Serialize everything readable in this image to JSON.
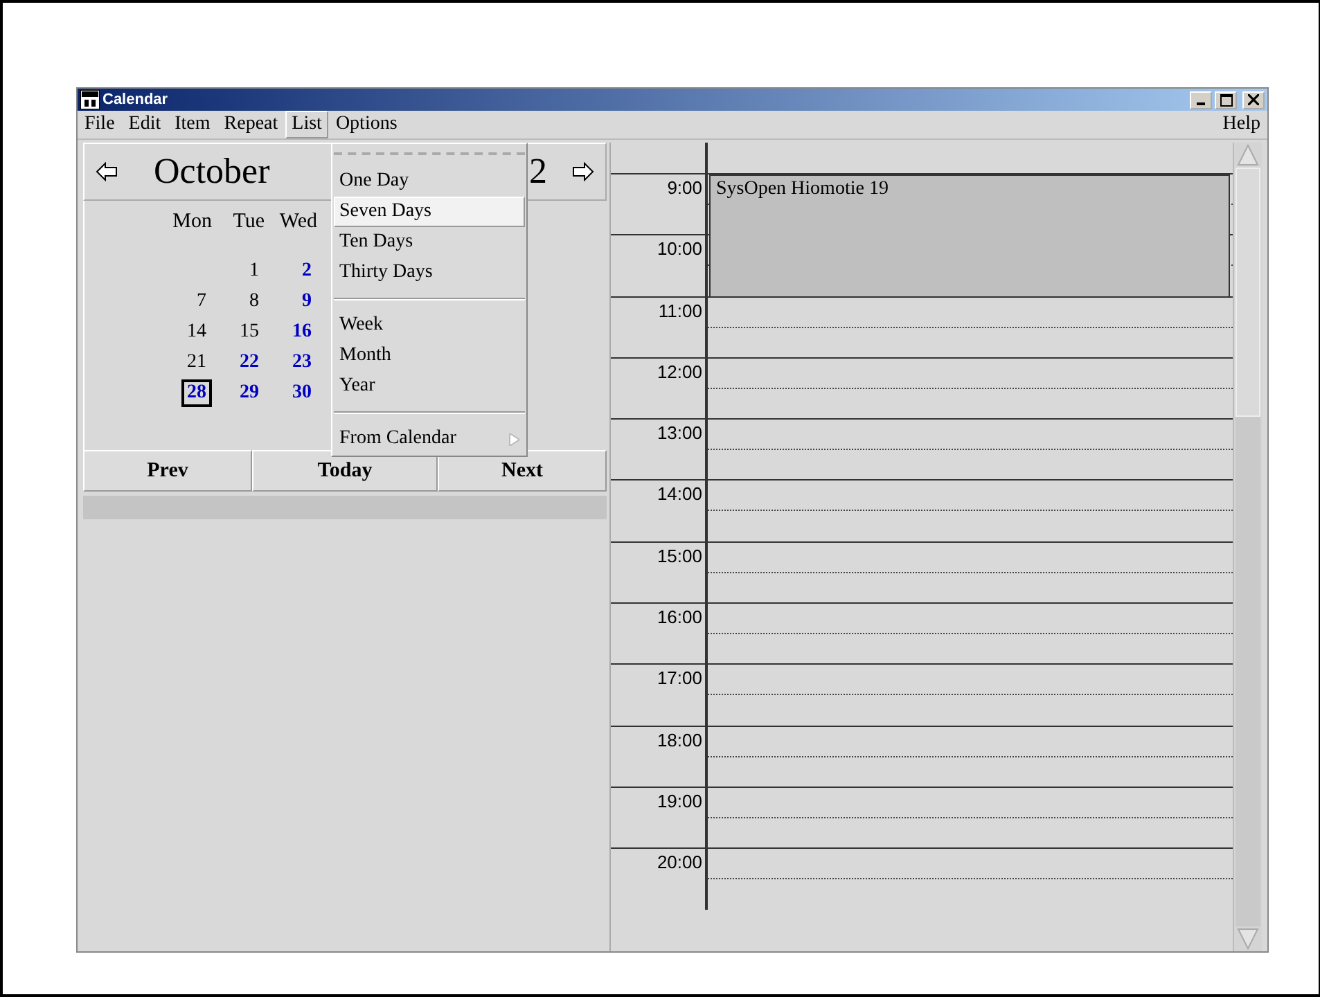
{
  "window": {
    "title": "Calendar"
  },
  "menu_bar": [
    {
      "label": "File",
      "selected": false
    },
    {
      "label": "Edit",
      "selected": false
    },
    {
      "label": "Item",
      "selected": false
    },
    {
      "label": "Repeat",
      "selected": false
    },
    {
      "label": "List",
      "selected": true
    },
    {
      "label": "Options",
      "selected": false
    }
  ],
  "help_menu": "Help",
  "month_nav": {
    "month": "October",
    "year": "2"
  },
  "calendar": {
    "weekdays": [
      "Mon",
      "Tue",
      "Wed"
    ],
    "weeks": [
      {
        "tue": {
          "label": "1",
          "marked": false,
          "selected": false
        },
        "wed": {
          "label": "2",
          "marked": true,
          "selected": false
        }
      },
      {
        "mon": {
          "label": "7",
          "marked": false,
          "selected": false
        },
        "tue": {
          "label": "8",
          "marked": false,
          "selected": false
        },
        "wed": {
          "label": "9",
          "marked": true,
          "selected": false
        }
      },
      {
        "mon": {
          "label": "14",
          "marked": false,
          "selected": false
        },
        "tue": {
          "label": "15",
          "marked": false,
          "selected": false
        },
        "wed": {
          "label": "16",
          "marked": true,
          "selected": false
        }
      },
      {
        "mon": {
          "label": "21",
          "marked": false,
          "selected": false
        },
        "tue": {
          "label": "22",
          "marked": true,
          "selected": false
        },
        "wed": {
          "label": "23",
          "marked": true,
          "selected": false
        }
      },
      {
        "mon": {
          "label": "28",
          "marked": true,
          "selected": true
        },
        "tue": {
          "label": "29",
          "marked": true,
          "selected": false
        },
        "wed": {
          "label": "30",
          "marked": true,
          "selected": false
        }
      }
    ]
  },
  "nav_buttons": [
    "Prev",
    "Today",
    "Next"
  ],
  "dropdown": [
    {
      "kind": "tearoff"
    },
    {
      "kind": "item",
      "label": "One Day",
      "selected": false
    },
    {
      "kind": "item",
      "label": "Seven Days",
      "selected": true
    },
    {
      "kind": "item",
      "label": "Ten Days",
      "selected": false
    },
    {
      "kind": "item",
      "label": "Thirty Days",
      "selected": false
    },
    {
      "kind": "separator"
    },
    {
      "kind": "item",
      "label": "Week",
      "selected": false
    },
    {
      "kind": "item",
      "label": "Month",
      "selected": false
    },
    {
      "kind": "item",
      "label": "Year",
      "selected": false
    },
    {
      "kind": "separator"
    },
    {
      "kind": "submenu",
      "label": "From Calendar",
      "selected": false
    }
  ],
  "day_view": {
    "hours": [
      "9:00",
      "10:00",
      "11:00",
      "12:00",
      "13:00",
      "14:00",
      "15:00",
      "16:00",
      "17:00",
      "18:00",
      "19:00",
      "20:00"
    ],
    "events": [
      {
        "title": "SysOpen Hiomotie 19"
      }
    ]
  }
}
